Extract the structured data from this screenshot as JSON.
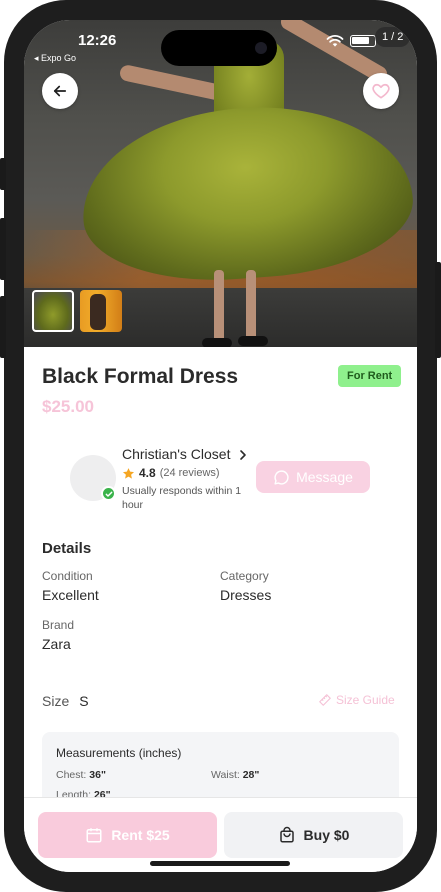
{
  "status_bar": {
    "time": "12:26",
    "back_app": "◂ Expo Go"
  },
  "gallery": {
    "counter": "1 / 2"
  },
  "product": {
    "title": "Black Formal Dress",
    "price": "$25.00",
    "listing_badge": "For Rent"
  },
  "seller": {
    "name": "Christian's Closet",
    "rating": "4.8",
    "reviews": "(24 reviews)",
    "responds": "Usually responds within 1 hour",
    "message_label": "Message"
  },
  "details": {
    "heading": "Details",
    "condition_label": "Condition",
    "condition_value": "Excellent",
    "category_label": "Category",
    "category_value": "Dresses",
    "brand_label": "Brand",
    "brand_value": "Zara",
    "size_label": "Size",
    "size_value": "S",
    "size_guide_label": "Size Guide"
  },
  "measurements": {
    "heading": "Measurements (inches)",
    "chest_label": "Chest:",
    "chest_value": "36\"",
    "waist_label": "Waist:",
    "waist_value": "28\"",
    "length_label": "Length:",
    "length_value": "26\""
  },
  "actions": {
    "rent_label": "Rent $25",
    "buy_label": "Buy $0"
  },
  "icons": [
    "back-arrow-icon",
    "heart-icon",
    "chevron-right-icon",
    "star-icon",
    "check-icon",
    "message-bubble-icon",
    "ruler-icon",
    "calendar-icon",
    "shopping-bag-icon",
    "wifi-icon",
    "battery-icon"
  ],
  "colors": {
    "accent_pink": "#f9cbdc",
    "badge_green": "#8ff08d",
    "verified_green": "#3ab34a",
    "star": "#f5a623"
  }
}
